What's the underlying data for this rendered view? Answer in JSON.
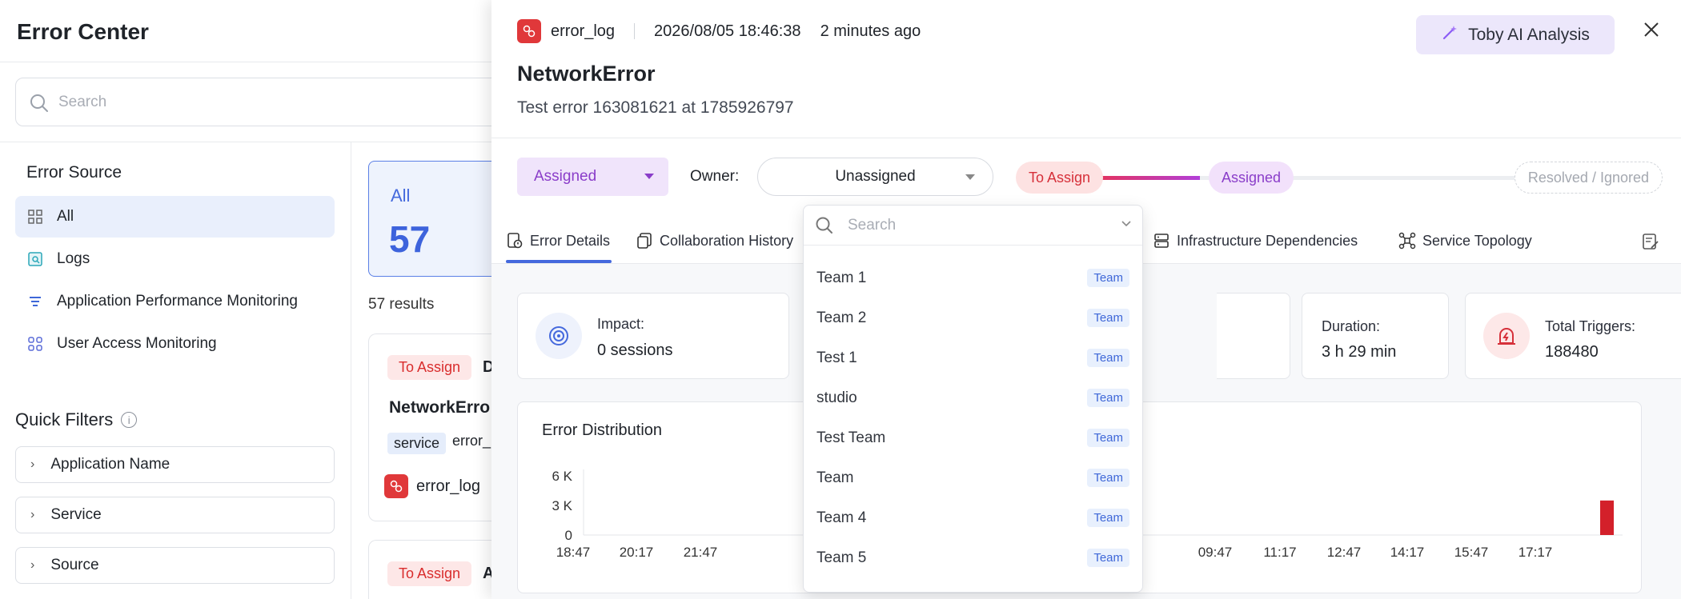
{
  "page": {
    "title": "Error Center",
    "search_placeholder": "Search",
    "error_source": {
      "title": "Error Source",
      "items": [
        {
          "label": "All",
          "icon": "grid-icon",
          "active": true
        },
        {
          "label": "Logs",
          "icon": "logs-icon",
          "active": false
        },
        {
          "label": "Application Performance Monitoring",
          "icon": "apm-icon",
          "active": false
        },
        {
          "label": "User Access Monitoring",
          "icon": "user-access-icon",
          "active": false
        }
      ]
    },
    "quick_filters": {
      "title": "Quick Filters",
      "info": "i",
      "items": [
        "Application Name",
        "Service",
        "Source"
      ]
    },
    "all_card": {
      "label": "All",
      "count": "57"
    },
    "results": "57 results",
    "list": [
      {
        "status": "To Assign",
        "status_extra": "D",
        "name": "NetworkErro",
        "tag_key": "service",
        "tag_value": "error_",
        "source": "error_log"
      },
      {
        "status": "To Assign",
        "status_extra": "A"
      }
    ]
  },
  "drawer": {
    "source": "error_log",
    "timestamp": "2026/08/05 18:46:38",
    "relative_time": "2 minutes ago",
    "ai_button": "Toby AI Analysis",
    "title": "NetworkError",
    "subtitle": "Test error 163081621 at 1785926797",
    "status_select": "Assigned",
    "owner_label": "Owner:",
    "owner_value": "Unassigned",
    "workflow": {
      "steps": [
        "To Assign",
        "Assigned",
        "Resolved / Ignored"
      ],
      "colors": {
        "to_assign": "#d6303a",
        "assigned": "#8a3dc9"
      }
    },
    "tabs": [
      {
        "label": "Error Details",
        "icon": "error-details-icon",
        "active": true
      },
      {
        "label": "Collaboration History",
        "icon": "copy-icon",
        "active": false
      },
      {
        "label": "Infrastructure Dependencies",
        "icon": "server-icon",
        "active": false
      },
      {
        "label": "Service Topology",
        "icon": "topology-icon",
        "active": false
      }
    ],
    "stats": {
      "impact_label": "Impact:",
      "impact_value": "0 sessions",
      "duration_label": "Duration:",
      "duration_value": "3 h 29 min",
      "triggers_label": "Total Triggers:",
      "triggers_value": "188480"
    },
    "distribution": {
      "title": "Error Distribution",
      "y_ticks": [
        "6 K",
        "3 K",
        "0"
      ],
      "x_ticks_left": [
        "18:47",
        "20:17",
        "21:47"
      ],
      "x_ticks_right": [
        "09:47",
        "11:17",
        "12:47",
        "14:17",
        "15:47",
        "17:17"
      ],
      "bar_color": "#d3202a"
    }
  },
  "owner_dropdown": {
    "search_placeholder": "Search",
    "items": [
      {
        "name": "Team 1",
        "tag": "Team"
      },
      {
        "name": "Team 2",
        "tag": "Team"
      },
      {
        "name": "Test 1",
        "tag": "Team"
      },
      {
        "name": "studio",
        "tag": "Team"
      },
      {
        "name": "Test Team",
        "tag": "Team"
      },
      {
        "name": "Team",
        "tag": "Team"
      },
      {
        "name": "Team 4",
        "tag": "Team"
      },
      {
        "name": "Team 5",
        "tag": "Team"
      }
    ]
  },
  "chart_data": {
    "type": "bar",
    "title": "Error Distribution",
    "xlabel": "",
    "ylabel": "",
    "y_ticks": [
      "0",
      "3 K",
      "6 K"
    ],
    "x_ticks": [
      "18:47",
      "20:17",
      "21:47",
      "09:47",
      "11:17",
      "12:47",
      "14:17",
      "15:47",
      "17:17"
    ],
    "ylim": [
      0,
      6000
    ],
    "categories": [
      "18:47",
      "20:17",
      "21:47",
      "09:47",
      "11:17",
      "12:47",
      "14:17",
      "15:47",
      "17:17",
      "18:47"
    ],
    "values": [
      0,
      0,
      0,
      0,
      0,
      0,
      0,
      0,
      0,
      3500
    ],
    "grid": false,
    "color": "#d3202a"
  }
}
